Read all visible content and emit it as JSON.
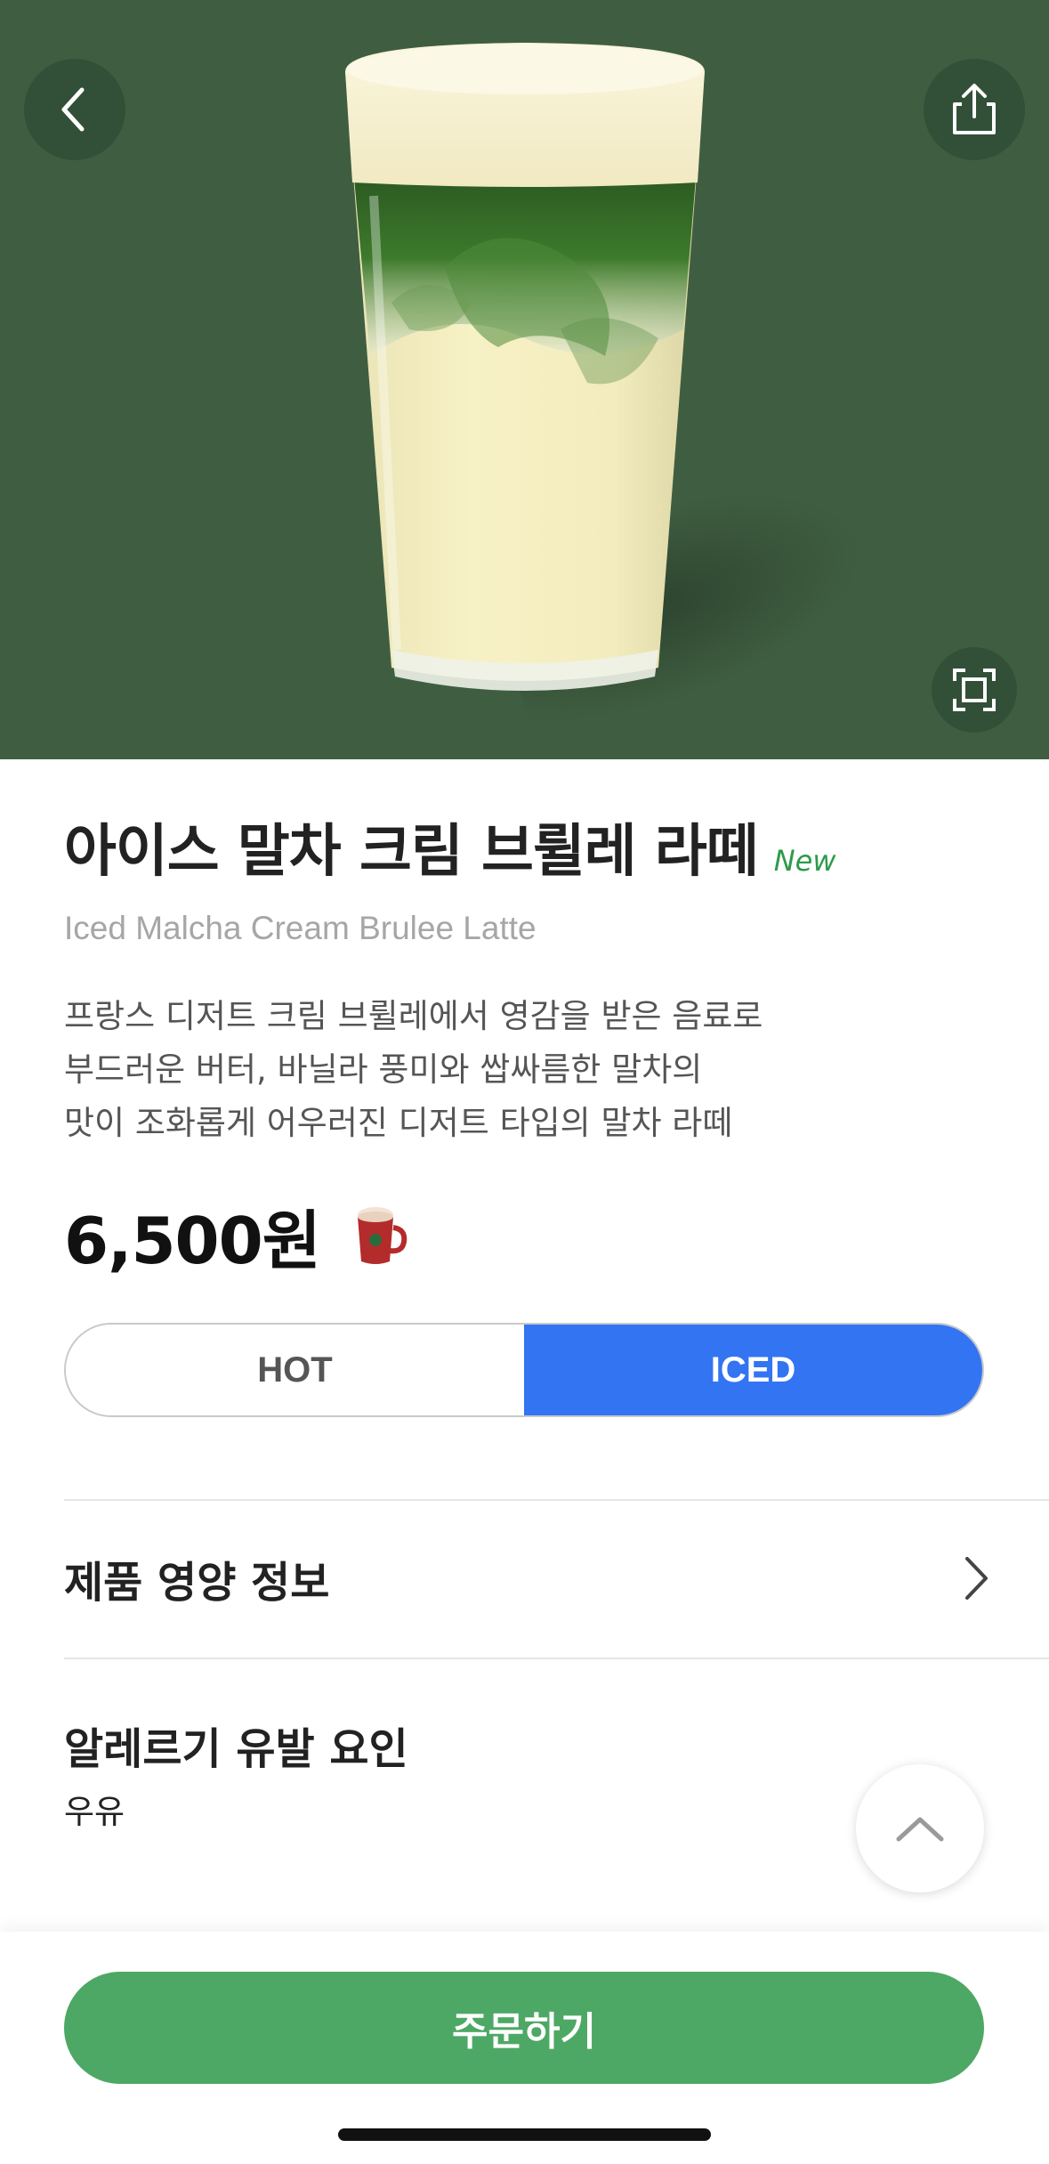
{
  "hero": {
    "icons": {
      "back": "chevron-left-icon",
      "share": "share-icon",
      "expand": "expand-icon"
    },
    "background_color": "#3f5e41"
  },
  "product": {
    "name_ko": "아이스 말차 크림 브륄레 라떼",
    "badge": "New",
    "name_en": "Iced Malcha Cream Brulee Latte",
    "description_lines": [
      "프랑스 디저트 크림 브륄레에서 영감을 받은 음료로",
      "부드러운 버터, 바닐라 풍미와 쌉싸름한 말차의",
      "맛이 조화롭게 어우러진 디저트 타입의 말차 라떼"
    ],
    "price": "6,500원",
    "price_icon": "mug-icon"
  },
  "temperature": {
    "options": [
      "HOT",
      "ICED"
    ],
    "selected": "ICED",
    "selected_color": "#3374f2"
  },
  "nutrition": {
    "label": "제품 영양 정보",
    "icon": "chevron-right-icon"
  },
  "allergy": {
    "label": "알레르기 유발 요인",
    "value": "우유"
  },
  "scroll_top": {
    "icon": "chevron-up-icon"
  },
  "order": {
    "label": "주문하기",
    "color": "#4ea865"
  }
}
